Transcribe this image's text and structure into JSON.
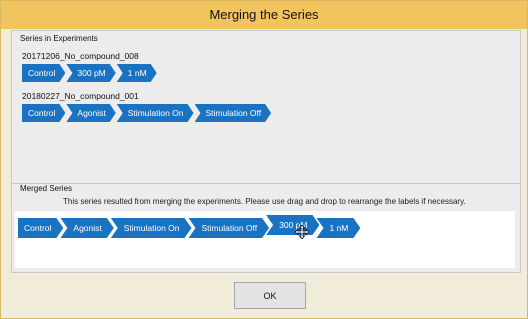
{
  "window": {
    "title": "Merging the Series"
  },
  "series_in_experiments": {
    "label": "Series in Experiments",
    "experiments": [
      {
        "name": "20171206_No_compound_008",
        "labels": [
          "Control",
          "300 pM",
          "1 nM"
        ]
      },
      {
        "name": "20180227_No_compound_001",
        "labels": [
          "Control",
          "Agonist",
          "Stimulation On",
          "Stimulation Off"
        ]
      }
    ]
  },
  "merged_series": {
    "label": "Merged Series",
    "hint": "This series resulted from merging the experiments. Please use drag and drop to rearrange the labels if necessary.",
    "labels": [
      "Control",
      "Agonist",
      "Stimulation On",
      "Stimulation Off",
      "300 pM",
      "1 nM"
    ],
    "dragging_label": "300 pM"
  },
  "buttons": {
    "ok": "OK"
  },
  "colors": {
    "title_bar": "#f2c45e",
    "chip": "#1a73c2",
    "window_bg": "#f0ecd9"
  },
  "icons": {
    "cursor": "move-cursor-icon"
  }
}
